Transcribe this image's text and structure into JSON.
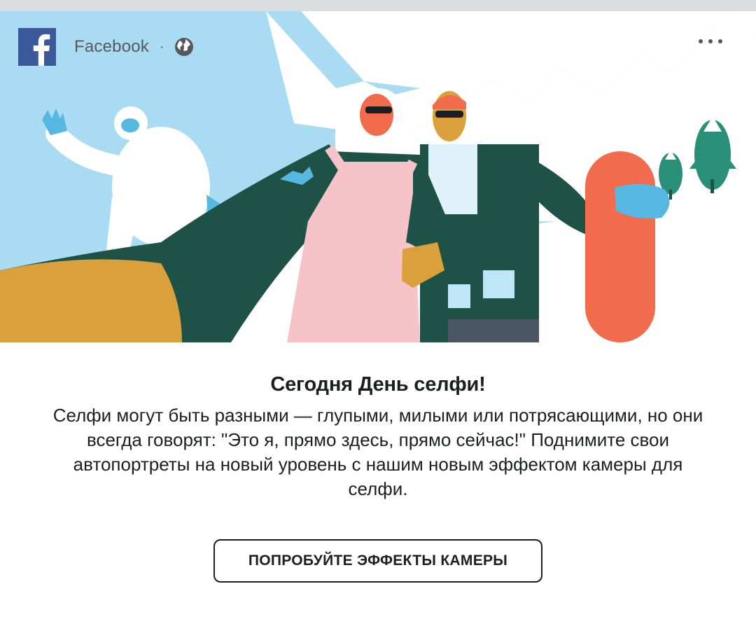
{
  "header": {
    "app_name": "Facebook",
    "separator": "·",
    "logo_icon": "facebook-logo-icon",
    "audience_icon": "globe-icon",
    "more_icon": "more-options-icon"
  },
  "hero": {
    "illustration": "selfie-day-illustration"
  },
  "content": {
    "title": "Сегодня День селфи!",
    "description": "Селфи могут быть разными — глупыми, милыми или потрясающими, но они всегда говорят: \"Это я, прямо здесь, прямо сейчас!\" Поднимите свои автопортреты на новый уровень с нашим новым эффектом камеры для селфи."
  },
  "cta": {
    "label": "ПОПРОБУЙТЕ ЭФФЕКТЫ КАМЕРЫ"
  },
  "colors": {
    "facebook_blue": "#3b5998",
    "sky": "#a9dcf3",
    "dark_green": "#1e5246",
    "pink": "#f6c4c8",
    "orange": "#f26b4c",
    "mustard": "#d9a03b",
    "text": "#1c1e21"
  }
}
